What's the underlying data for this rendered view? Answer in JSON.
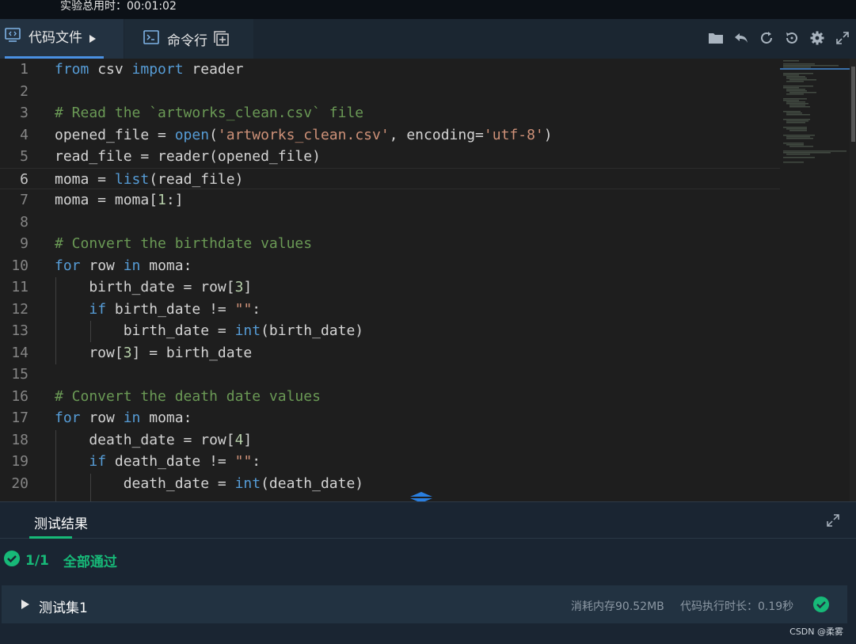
{
  "timer": {
    "text": "实验总用时：00:01:02"
  },
  "tabs": {
    "code_label": "代码文件",
    "cmd_label": "命令行"
  },
  "toolbar": {
    "icons": [
      "folder-icon",
      "undo-icon",
      "refresh-icon",
      "history-icon",
      "settings-icon",
      "fullscreen-icon"
    ]
  },
  "editor": {
    "current_line": 6,
    "lines": [
      {
        "n": "1"
      },
      {
        "n": "2"
      },
      {
        "n": "3"
      },
      {
        "n": "4"
      },
      {
        "n": "5"
      },
      {
        "n": "6"
      },
      {
        "n": "7"
      },
      {
        "n": "8"
      },
      {
        "n": "9"
      },
      {
        "n": "10"
      },
      {
        "n": "11"
      },
      {
        "n": "12"
      },
      {
        "n": "13"
      },
      {
        "n": "14"
      },
      {
        "n": "15"
      },
      {
        "n": "16"
      },
      {
        "n": "17"
      },
      {
        "n": "18"
      },
      {
        "n": "19"
      },
      {
        "n": "20"
      }
    ],
    "code": [
      "from csv import reader",
      "",
      "# Read the `artworks_clean.csv` file",
      "opened_file = open('artworks_clean.csv', encoding='utf-8')",
      "read_file = reader(opened_file)",
      "moma = list(read_file)",
      "moma = moma[1:]",
      "",
      "# Convert the birthdate values",
      "for row in moma:",
      "    birth_date = row[3]",
      "    if birth_date != \"\":",
      "        birth_date = int(birth_date)",
      "    row[3] = birth_date",
      "",
      "# Convert the death date values",
      "for row in moma:",
      "    death_date = row[4]",
      "    if death_date != \"\":",
      "        death_date = int(death_date)"
    ]
  },
  "results": {
    "tab_label": "测试结果",
    "summary_count": "1/1",
    "summary_text": "全部通过",
    "testset": {
      "name": "测试集1",
      "memory": "消耗内存90.52MB",
      "time": "代码执行时长：0.19秒"
    },
    "colors": {
      "pass": "#17b978",
      "accent": "#4a90e2"
    }
  },
  "watermark": "CSDN @柔雾"
}
